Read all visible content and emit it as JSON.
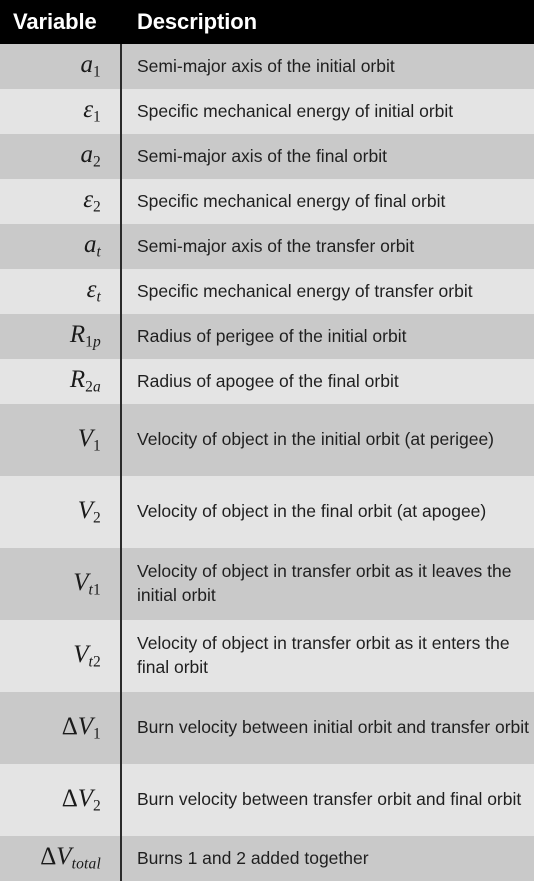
{
  "table": {
    "header": {
      "variable_label": "Variable",
      "description_label": "Description"
    },
    "colors": {
      "header_bg": "#000000",
      "header_text": "#ffffff",
      "row_odd_bg": "#c9c9c9",
      "row_even_bg": "#e4e4e4",
      "divider": "#2b2b2b",
      "body_text": "#1f1f1f"
    },
    "rows": [
      {
        "variable_plain": "a₁",
        "var_base": "a",
        "var_sub": "1",
        "var_sub_style": "upright",
        "var_prefix": "",
        "description": "Semi-major axis of the initial orbit",
        "lines": 1
      },
      {
        "variable_plain": "ε₁",
        "var_base": "ɛ",
        "var_sub": "1",
        "var_sub_style": "upright",
        "var_prefix": "",
        "description": "Specific mechanical energy of initial orbit",
        "lines": 1
      },
      {
        "variable_plain": "a₂",
        "var_base": "a",
        "var_sub": "2",
        "var_sub_style": "upright",
        "var_prefix": "",
        "description": "Semi-major axis of the final orbit",
        "lines": 1
      },
      {
        "variable_plain": "ε₂",
        "var_base": "ɛ",
        "var_sub": "2",
        "var_sub_style": "upright",
        "var_prefix": "",
        "description": "Specific mechanical energy of final orbit",
        "lines": 1
      },
      {
        "variable_plain": "aₜ",
        "var_base": "a",
        "var_sub": "t",
        "var_sub_style": "italic",
        "var_prefix": "",
        "description": "Semi-major axis of the transfer orbit",
        "lines": 1
      },
      {
        "variable_plain": "εₜ",
        "var_base": "ɛ",
        "var_sub": "t",
        "var_sub_style": "italic",
        "var_prefix": "",
        "description": "Specific mechanical energy of transfer orbit",
        "lines": 1
      },
      {
        "variable_plain": "R₁ₚ",
        "var_base": "R",
        "var_sub": "1p",
        "var_sub_style": "mixed",
        "var_prefix": "",
        "description": "Radius of perigee of the initial orbit",
        "lines": 1
      },
      {
        "variable_plain": "R₂ₐ",
        "var_base": "R",
        "var_sub": "2a",
        "var_sub_style": "mixed",
        "var_prefix": "",
        "description": "Radius of apogee of the final orbit",
        "lines": 1
      },
      {
        "variable_plain": "V₁",
        "var_base": "V",
        "var_sub": "1",
        "var_sub_style": "upright",
        "var_prefix": "",
        "description": "Velocity of object in the initial orbit (at perigee)",
        "lines": 2
      },
      {
        "variable_plain": "V₂",
        "var_base": "V",
        "var_sub": "2",
        "var_sub_style": "upright",
        "var_prefix": "",
        "description": "Velocity of object in the final orbit (at apogee)",
        "lines": 2
      },
      {
        "variable_plain": "Vₜ₁",
        "var_base": "V",
        "var_sub": "t1",
        "var_sub_style": "mixed",
        "var_prefix": "",
        "description": "Velocity of object in transfer orbit as it leaves the initial orbit",
        "lines": 2
      },
      {
        "variable_plain": "Vₜ₂",
        "var_base": "V",
        "var_sub": "t2",
        "var_sub_style": "mixed",
        "var_prefix": "",
        "description": "Velocity of object in transfer orbit as it enters the final orbit",
        "lines": 2
      },
      {
        "variable_plain": "ΔV₁",
        "var_base": "V",
        "var_sub": "1",
        "var_sub_style": "upright",
        "var_prefix": "Δ",
        "description": "Burn velocity between initial orbit and transfer orbit",
        "lines": 2
      },
      {
        "variable_plain": "ΔV₂",
        "var_base": "V",
        "var_sub": "2",
        "var_sub_style": "upright",
        "var_prefix": "Δ",
        "description": "Burn velocity between transfer orbit and final orbit",
        "lines": 2
      },
      {
        "variable_plain": "ΔV_total",
        "var_base": "V",
        "var_sub": "total",
        "var_sub_style": "italic",
        "var_prefix": "Δ",
        "description": "Burns 1 and 2 added together",
        "lines": 1
      }
    ]
  }
}
